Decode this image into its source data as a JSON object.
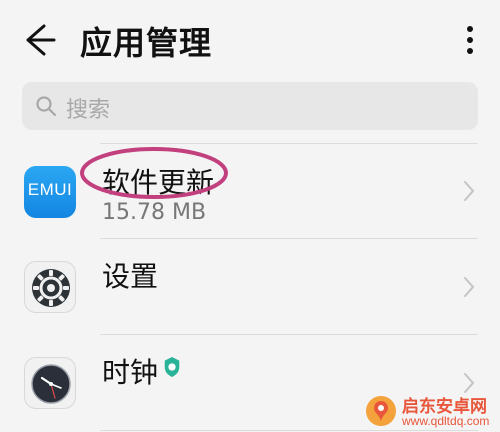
{
  "header": {
    "title": "应用管理",
    "back_icon": "arrow-left-icon",
    "more_icon": "more-vertical-icon"
  },
  "search": {
    "placeholder": "搜索",
    "icon": "search-icon"
  },
  "apps": [
    {
      "name": "软件更新",
      "size": "15.78 MB",
      "icon": "emui-icon",
      "icon_text": "EMUI",
      "highlighted": true
    },
    {
      "name": "设置",
      "size": "",
      "icon": "settings-gear-icon"
    },
    {
      "name": "时钟",
      "size": "",
      "icon": "clock-icon",
      "badge_icon": "security-badge-icon"
    }
  ],
  "watermark": {
    "title": "启东安卓网",
    "url": "www.qdltdq.com"
  },
  "colors": {
    "background": "#f4f4f4",
    "search_bg": "#e7e7e7",
    "highlight_ellipse": "#c2407e",
    "emui_blue": "#1d93e8",
    "badge_teal": "#2bb39a",
    "watermark_orange": "#e8573b"
  }
}
